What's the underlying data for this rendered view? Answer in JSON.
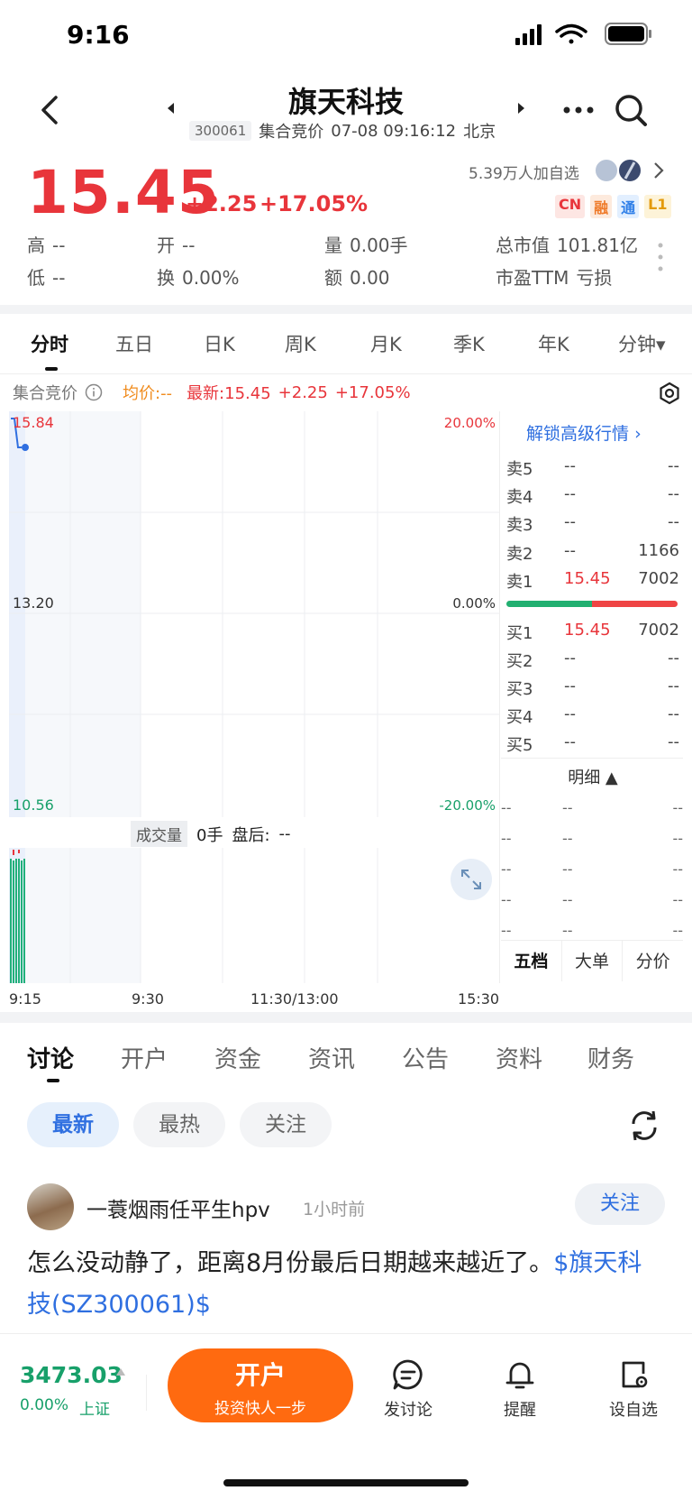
{
  "status_bar": {
    "time": "9:16"
  },
  "header": {
    "stock_name": "旗天科技",
    "stock_code": "300061",
    "session": "集合竞价",
    "datetime": "07-08 09:16:12",
    "city": "北京"
  },
  "quote": {
    "price": "15.45",
    "change": "+2.25",
    "change_pct": "+17.05%",
    "watchers": "5.39万人加自选",
    "tags": [
      "CN",
      "融",
      "通",
      "L1"
    ],
    "stats": {
      "high_label": "高",
      "high_value": "--",
      "low_label": "低",
      "low_value": "--",
      "open_label": "开",
      "open_value": "--",
      "turnover_label": "换",
      "turnover_value": "0.00%",
      "volume_label": "量",
      "volume_value": "0.00手",
      "amount_label": "额",
      "amount_value": "0.00",
      "mcap_label": "总市值",
      "mcap_value": "101.81亿",
      "pe_label": "市盈TTM",
      "pe_value": "亏损"
    }
  },
  "k_tabs": [
    "分时",
    "五日",
    "日K",
    "周K",
    "月K",
    "季K",
    "年K",
    "分钟▾"
  ],
  "chart_info": {
    "auction_label": "集合竞价",
    "avg_label": "均价:--",
    "latest_label": "最新:15.45",
    "change": "+2.25",
    "change_pct": "+17.05%"
  },
  "chart_data": {
    "type": "line",
    "y_ticks_left": [
      "15.84",
      "13.20",
      "10.56"
    ],
    "y_ticks_right": [
      "20.00%",
      "0.00%",
      "-20.00%"
    ],
    "x_ticks": [
      "9:15",
      "9:30",
      "11:30/13:00",
      "15:30"
    ],
    "ylim": [
      10.56,
      15.84
    ],
    "series": [
      {
        "values": [
          15.84,
          15.84,
          15.45,
          15.45
        ]
      }
    ],
    "volume_label": "成交量",
    "volume_value": "0手",
    "after_hours_label": "盘后:",
    "after_hours_value": "--"
  },
  "order_book": {
    "unlock_label": "解锁高级行情",
    "asks": [
      {
        "label": "卖5",
        "price": "--",
        "vol": "--"
      },
      {
        "label": "卖4",
        "price": "--",
        "vol": "--"
      },
      {
        "label": "卖3",
        "price": "--",
        "vol": "--"
      },
      {
        "label": "卖2",
        "price": "--",
        "vol": "1166"
      },
      {
        "label": "卖1",
        "price": "15.45",
        "vol": "7002"
      }
    ],
    "bids": [
      {
        "label": "买1",
        "price": "15.45",
        "vol": "7002"
      },
      {
        "label": "买2",
        "price": "--",
        "vol": "--"
      },
      {
        "label": "买3",
        "price": "--",
        "vol": "--"
      },
      {
        "label": "买4",
        "price": "--",
        "vol": "--"
      },
      {
        "label": "买5",
        "price": "--",
        "vol": "--"
      }
    ],
    "detail_label": "明细 ▲",
    "detail_rows": [
      [
        "--",
        "--",
        "--"
      ],
      [
        "--",
        "--",
        "--"
      ],
      [
        "--",
        "--",
        "--"
      ],
      [
        "--",
        "--",
        "--"
      ],
      [
        "--",
        "--",
        "--"
      ]
    ],
    "tabs": [
      "五档",
      "大单",
      "分价"
    ]
  },
  "discussion": {
    "tabs": [
      "讨论",
      "开户",
      "资金",
      "资讯",
      "公告",
      "资料",
      "财务"
    ],
    "filters": [
      "最新",
      "最热",
      "关注"
    ],
    "post": {
      "user": "一蓑烟雨任平生hpv",
      "time": "1小时前",
      "follow_label": "关注",
      "text": "怎么没动静了，距离8月份最后日期越来越近了。",
      "link": "$旗天科技(SZ300061)$"
    }
  },
  "bottom_bar": {
    "index_value": "3473.03",
    "index_pct": "0.00%",
    "index_name": "上证",
    "open_title": "开户",
    "open_sub": "投资快人一步",
    "nav": [
      "发讨论",
      "提醒",
      "设自选"
    ]
  }
}
